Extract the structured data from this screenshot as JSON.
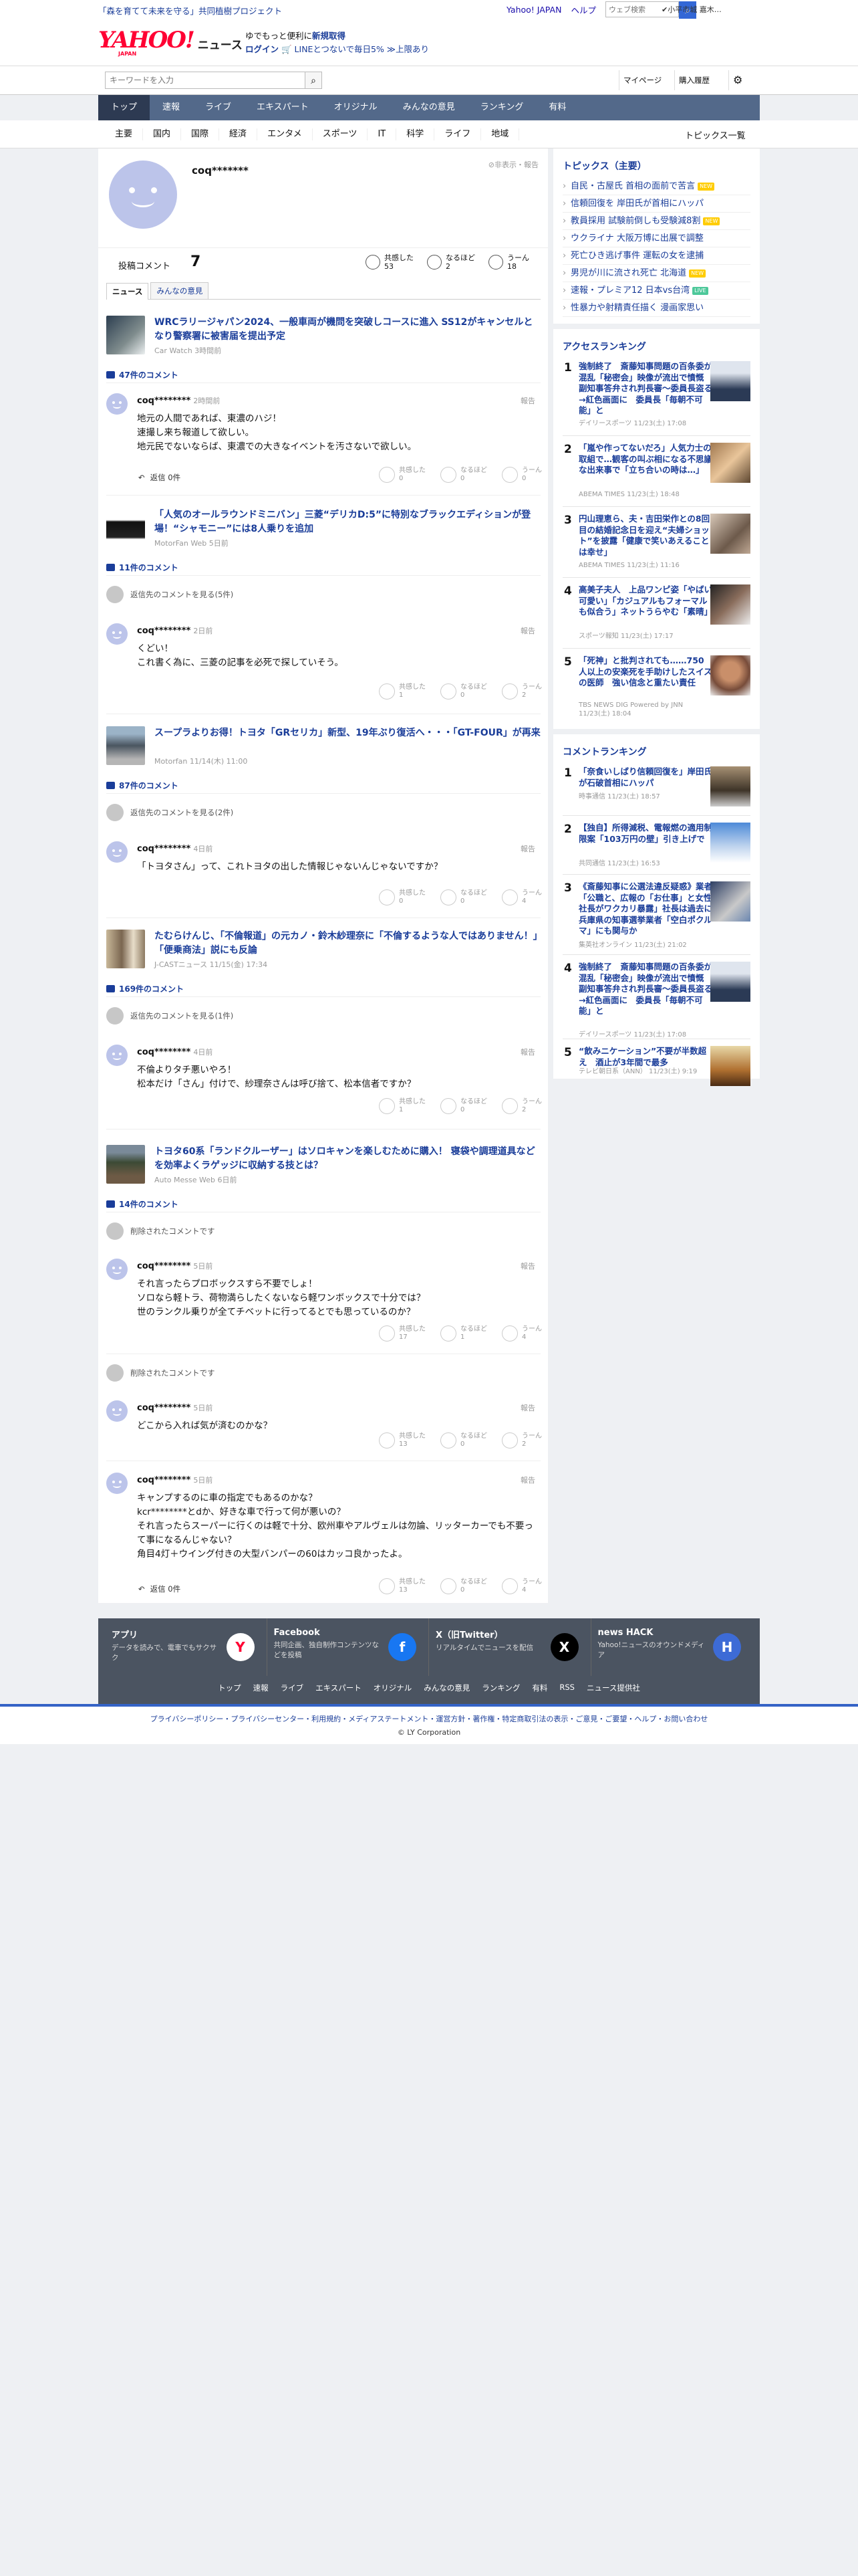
{
  "header": {
    "promo": "「森を育てて未来を守る」共同植樹プロジェクト",
    "top_links": [
      "Yahoo! JAPAN",
      "ヘルプ"
    ],
    "top_search_placeholder": "ウェブ検索",
    "location": "✔小平市城 嘉木…",
    "logo": "YAHOO!",
    "logo_jp": "JAPAN",
    "logo_news": "ニュース",
    "logo_msg_1": "ゆでもっと便利に",
    "logo_msg_bold": "新規取得",
    "logo_msg_2": "ログイン",
    "logo_msg_3": "🛒 LINEとつないで毎日5% ≫上限あり",
    "search_placeholder": "キーワードを入力",
    "mypage": "マイページ",
    "history": "購入履歴"
  },
  "gnav": [
    "トップ",
    "速報",
    "ライブ",
    "エキスパート",
    "オリジナル",
    "みんなの意見",
    "ランキング",
    "有料"
  ],
  "snav": [
    "主要",
    "国内",
    "国際",
    "経済",
    "エンタメ",
    "スポーツ",
    "IT",
    "科学",
    "ライフ",
    "地域"
  ],
  "snav_all": "トピックス一覧",
  "profile": {
    "name": "coq*******",
    "hidden": "非表示・報告",
    "post_label": "投稿コメント",
    "post_count": "7",
    "reactions": [
      {
        "label": "共感した",
        "n": "53"
      },
      {
        "label": "なるほど",
        "n": "2"
      },
      {
        "label": "うーん",
        "n": "18"
      }
    ],
    "tabs": [
      "ニュース",
      "みんなの意見"
    ]
  },
  "threads": [
    {
      "title": "WRCラリージャパン2024、一般車両が機問を突破しコースに進入 SS12がキャンセルとなり警察署に被害届を提出予定",
      "src": "Car Watch 3時間前",
      "count": "47件のコメント",
      "name": "coq********",
      "time": "2時間前",
      "body": "地元の人間であれば、東濃のハジ！\n速撮し来ち報道して欲しい。\n地元民でないならば、東濃での大きなイベントを汚さないで欲しい。",
      "r": [
        "0",
        "0",
        "0"
      ],
      "reply": "返信 0件"
    },
    {
      "title": "「人気のオールラウンドミニバン」三菱“デリカD:5”に特別なブラックエディションが登場！“シャモニー”には8人乗りを追加",
      "src": "MotorFan Web 5日前",
      "count": "11件のコメント",
      "gray": "返信先のコメントを見る(5件)",
      "name": "coq********",
      "time": "2日前",
      "body": "くどい！\nこれ書く為に、三菱の記事を必死で探していそう。",
      "r": [
        "1",
        "0",
        "2"
      ]
    },
    {
      "title": "スープラよりお得！トヨタ「GRセリカ」新型、19年ぶり復活へ・・・「GT-FOUR」が再来",
      "src": "Motorfan 11/14(木) 11:00",
      "count": "87件のコメント",
      "gray": "返信先のコメントを見る(2件)",
      "name": "coq********",
      "time": "4日前",
      "body": "「トヨタさん」って、これトヨタの出した情報じゃないんじゃないですか？",
      "r": [
        "0",
        "0",
        "4"
      ]
    },
    {
      "title": "たむらけんじ、「不倫報道」の元カノ・鈴木紗理奈に「不倫するような人ではありません！」「便乗商法」説にも反論",
      "src": "J-CASTニュース 11/15(金) 17:34",
      "count": "169件のコメント",
      "gray": "返信先のコメントを見る(1件)",
      "name": "coq********",
      "time": "4日前",
      "body": "不倫よりタチ悪いやろ！\n松本だけ「さん」付けで、紗理奈さんは呼び捨て、松本信者ですか？",
      "r": [
        "1",
        "0",
        "2"
      ]
    },
    {
      "title": "トヨタ60系「ランドクルーザー」はソロキャンを楽しむために購入！ 寝袋や調理道具などを効率よくラゲッジに収納する技とは？",
      "src": "Auto Messe Web 6日前",
      "count": "14件のコメント",
      "gray": "削除されたコメントです",
      "name": "coq********",
      "time": "5日前",
      "body": "それ言ったらプロボックスすら不要でしょ！\nソロなら軽トラ、荷物満らしたくないなら軽ワンボックスで十分では？\n世のランクル乗りが全てチベットに行ってるとでも思っているのか？",
      "r": [
        "17",
        "1",
        "4"
      ]
    }
  ],
  "extra": [
    {
      "gray": "削除されたコメントです",
      "name": "coq********",
      "time": "5日前",
      "body": "どこから入れば気が済むのかな？",
      "r": [
        "13",
        "0",
        "2"
      ]
    },
    {
      "name": "coq********",
      "time": "5日前",
      "body": "キャンプするのに車の指定でもあるのかな？\nkcr********とdか、好きな車で行って何が悪いの？\nそれ言ったらスーパーに行くのは軽で十分、欧州車やアルヴェルは勿論、リッターカーでも不要って事になるんじゃない？\n角目4灯＋ウイング付きの大型バンパーの60はカッコ良かったよ。",
      "r": [
        "13",
        "0",
        "4"
      ],
      "reply": "返信 0件"
    }
  ],
  "react_labels": [
    "共感した",
    "なるほど",
    "うーん"
  ],
  "report": "報告",
  "side": {
    "topics_title": "トピックス（主要）",
    "topics": [
      {
        "t": "自民・古屋氏 首相の面前で苦言",
        "b": "new"
      },
      {
        "t": "信頼回復を 岸田氏が首相にハッパ"
      },
      {
        "t": "教員採用 試験前倒しも受験減8割",
        "b": "new"
      },
      {
        "t": "ウクライナ 大阪万博に出展で調整"
      },
      {
        "t": "死亡ひき逃げ事件 運転の女を逮捕"
      },
      {
        "t": "男児が川に流され死亡 北海道",
        "b": "new"
      },
      {
        "t": "速報・プレミア12 日本vs台湾",
        "b": "live"
      },
      {
        "t": "性暴力や射精責任描く 漫画家思い"
      }
    ],
    "access_title": "アクセスランキング",
    "access": [
      {
        "t": "強制終了　斎藤知事問題の百条委が混乱「秘密会」映像が流出で憤慨 副知事答弁され判長審〜委員長盗る→紅色画面に　委員長「毎朝不可能」と",
        "s": "デイリースポーツ 11/23(土) 17:08"
      },
      {
        "t": "「嵐や作ってないだろ」人気力士の取組で…観客の叫ぶ相になる不思議な出来事で「立ち合いの時は…」",
        "s": "ABEMA TIMES 11/23(土) 18:48"
      },
      {
        "t": "円山理恵ら、夫・吉田栄作との8回目の結婚記念日を迎え“夫婦ショット”を披露「健康で笑いあえることは幸せ」",
        "s": "ABEMA TIMES 11/23(土) 11:16"
      },
      {
        "t": "高美子夫人　上品ワンピ姿「やばい可愛い」「カジュアルもフォーマルも似合う」ネットうらやむ「素晴」",
        "s": "スポーツ報知 11/23(土) 17:17"
      },
      {
        "t": "「死神」と批判されても……750人以上の安楽死を手助けしたスイスの医師　強い信念と重たい責任",
        "s": "TBS NEWS DIG Powered by JNN 11/23(土) 18:04"
      }
    ],
    "comment_title": "コメントランキング",
    "comment": [
      {
        "t": "「奈食いしばり信頼回復を」岸田氏が石破首相にハッパ",
        "s": "時事通信 11/23(土) 18:57"
      },
      {
        "t": "【独自】所得減税、電報燃の適用制限案「103万円の壁」引き上げで",
        "s": "共同通信 11/23(土) 16:53"
      },
      {
        "t": "《斎藤知事に公選法違反疑惑》業者「公職と、広報の「お仕事」と女性社長がワクカリ暴露」社長は過去に兵庫県の知事選挙業者「空白ポクルマ」にも関与か",
        "s": "集英社オンライン 11/23(土) 21:02"
      },
      {
        "t": "強制終了　斎藤知事問題の百条委が混乱「秘密会」映像が流出で憤慨　副知事答弁され判長審〜委員長盗る→紅色画面に　委員長「毎朝不可能」と",
        "s": "デイリースポーツ 11/23(土) 17:08"
      },
      {
        "t": "“飲みニケーション”不要が半数超え　酒止が3年間で最多",
        "s": "テレビ朝日系（ANN） 11/23(土) 9:19"
      }
    ]
  },
  "footer": {
    "apps": [
      {
        "t": "アプリ",
        "d": "データを読みで、電車でもサクサク",
        "i": "Y"
      },
      {
        "t": "Facebook",
        "d": "共同企画、独自制作コンテンツなどを投稿",
        "i": "f"
      },
      {
        "t": "X（旧Twitter）",
        "d": "リアルタイムでニュースを配信",
        "i": "X"
      },
      {
        "t": "news HACK",
        "d": "Yahoo!ニュースのオウンドメディア",
        "i": "H"
      }
    ],
    "links": [
      "トップ",
      "速報",
      "ライブ",
      "エキスパート",
      "オリジナル",
      "みんなの意見",
      "ランキング",
      "有料",
      "RSS",
      "ニュース提供社"
    ],
    "policy": "プライバシーポリシー・プライバシーセンター・利用規約・メディアステートメント・運営方針・著作権・特定商取引法の表示・ご意見・ご要望・ヘルプ・お問い合わせ",
    "copy": "© LY Corporation"
  }
}
